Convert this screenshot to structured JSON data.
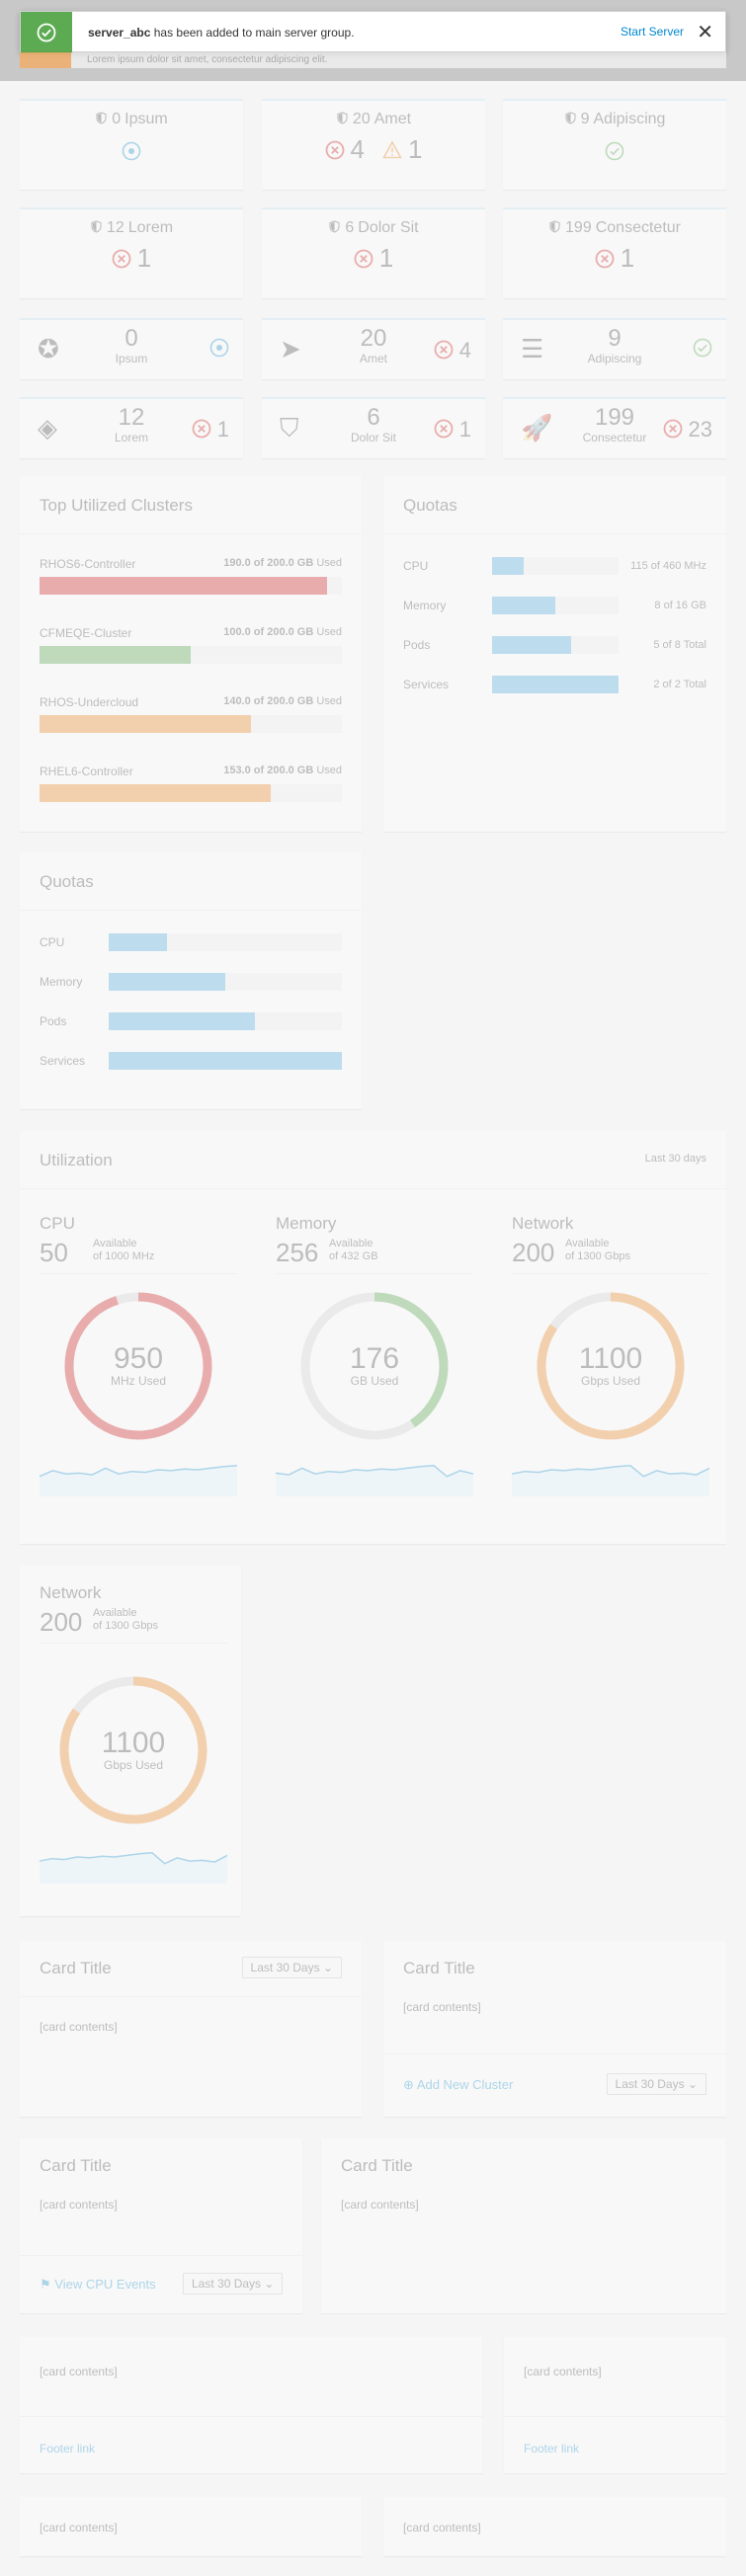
{
  "toast": {
    "user": "server_abc",
    "message": " has been added to main server group.",
    "action": "Start Server",
    "sub": "Lorem ipsum dolor sit amet, consectetur adipiscing elit."
  },
  "summary_row1": [
    {
      "count": "0",
      "label": "Ipsum",
      "status": "add"
    },
    {
      "count": "20",
      "label": "Amet",
      "errors": "4",
      "warnings": "1"
    },
    {
      "count": "9",
      "label": "Adipiscing",
      "status": "ok"
    }
  ],
  "summary_row2": [
    {
      "count": "12",
      "label": "Lorem",
      "errors": "1"
    },
    {
      "count": "6",
      "label": "Dolor Sit",
      "errors": "1"
    },
    {
      "count": "199",
      "label": "Consectetur",
      "errors": "1"
    }
  ],
  "mini_row1": [
    {
      "icon": "rebel-icon",
      "count": "0",
      "label": "Ipsum",
      "status": "add"
    },
    {
      "icon": "paper-plane-icon",
      "count": "20",
      "label": "Amet",
      "errors": "4"
    },
    {
      "icon": "server-icon",
      "count": "9",
      "label": "Adipiscing",
      "status": "ok"
    }
  ],
  "mini_row2": [
    {
      "icon": "layers-icon",
      "count": "12",
      "label": "Lorem",
      "errors": "1"
    },
    {
      "icon": "shield-icon",
      "count": "6",
      "label": "Dolor Sit",
      "errors": "1"
    },
    {
      "icon": "rocket-icon",
      "count": "199",
      "label": "Consectetur",
      "errors": "23"
    }
  ],
  "top_clusters": {
    "title": "Top Utilized Clusters",
    "unit_word": "Used",
    "items": [
      {
        "name": "RHOS6-Controller",
        "value": "190.0 of 200.0 GB",
        "pct": 95,
        "color": "#cc0000"
      },
      {
        "name": "CFMEQE-Cluster",
        "value": "100.0 of 200.0 GB",
        "pct": 50,
        "color": "#3f9c35"
      },
      {
        "name": "RHOS-Undercloud",
        "value": "140.0 of 200.0 GB",
        "pct": 70,
        "color": "#ec7a08"
      },
      {
        "name": "RHEL6-Controller",
        "value": "153.0 of 200.0 GB",
        "pct": 76.5,
        "color": "#ec7a08"
      }
    ]
  },
  "quotas_a": {
    "title": "Quotas",
    "items": [
      {
        "name": "CPU",
        "value": "115 of 460 MHz",
        "pct": 25
      },
      {
        "name": "Memory",
        "value": "8 of 16 GB",
        "pct": 50
      },
      {
        "name": "Pods",
        "value": "5 of 8 Total",
        "pct": 62.5
      },
      {
        "name": "Services",
        "value": "2 of 2 Total",
        "pct": 100
      }
    ]
  },
  "quotas_b": {
    "title": "Quotas",
    "items": [
      {
        "name": "CPU",
        "pct": 25
      },
      {
        "name": "Memory",
        "pct": 50
      },
      {
        "name": "Pods",
        "pct": 62.5
      },
      {
        "name": "Services",
        "pct": 100
      }
    ]
  },
  "utilization": {
    "title": "Utilization",
    "range": "Last 30 days",
    "charts": [
      {
        "name": "CPU",
        "available": "50",
        "avail_label": "Available",
        "of": "of 1000 MHz",
        "used": "950",
        "used_label": "MHz Used",
        "pct": 95,
        "color": "#cc0000"
      },
      {
        "name": "Memory",
        "available": "256",
        "avail_label": "Available",
        "of": "of 432 GB",
        "used": "176",
        "used_label": "GB Used",
        "pct": 40.7,
        "color": "#3f9c35"
      },
      {
        "name": "Network",
        "available": "200",
        "avail_label": "Available",
        "of": "of 1300 Gbps",
        "used": "1100",
        "used_label": "Gbps Used",
        "pct": 84.6,
        "color": "#ec7a08"
      }
    ]
  },
  "network_card": {
    "name": "Network",
    "available": "200",
    "avail_label": "Available",
    "of": "of 1300 Gbps",
    "used": "1100",
    "used_label": "Gbps Used",
    "pct": 84.6,
    "color": "#ec7a08"
  },
  "cards": {
    "a": {
      "title": "Card Title",
      "body": "[card contents]",
      "dropdown": "Last 30 Days"
    },
    "b": {
      "title": "Card Title",
      "body": "[card contents]",
      "footer_link": "Add New Cluster",
      "dropdown": "Last 30 Days"
    },
    "c": {
      "title": "Card Title",
      "body": "[card contents]",
      "footer_link": "View CPU Events",
      "dropdown": "Last 30 Days"
    },
    "d": {
      "title": "Card Title",
      "body": "[card contents]"
    },
    "e": {
      "body": "[card contents]",
      "footer_link": "Footer link"
    },
    "f": {
      "body": "[card contents]",
      "footer_link": "Footer link"
    },
    "g": {
      "body": "[card contents]"
    },
    "h": {
      "body": "[card contents]"
    }
  }
}
